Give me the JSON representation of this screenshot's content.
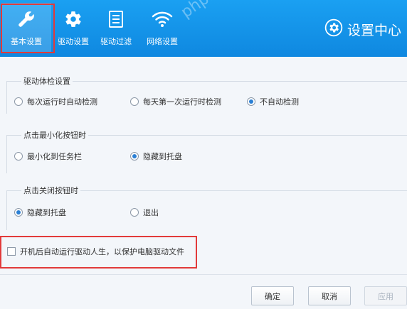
{
  "header": {
    "tabs": [
      {
        "label": "基本设置",
        "icon": "wrench-icon",
        "active": true
      },
      {
        "label": "驱动设置",
        "icon": "gear-icon",
        "active": false
      },
      {
        "label": "驱动过滤",
        "icon": "list-icon",
        "active": false
      },
      {
        "label": "网络设置",
        "icon": "wifi-icon",
        "active": false
      }
    ],
    "title": "设置中心",
    "watermark": "php.cn"
  },
  "groups": {
    "scan": {
      "title": "驱动体检设置",
      "options": [
        {
          "label": "每次运行时自动检测",
          "selected": false
        },
        {
          "label": "每天第一次运行时检测",
          "selected": false
        },
        {
          "label": "不自动检测",
          "selected": true
        }
      ]
    },
    "minimize": {
      "title": "点击最小化按钮时",
      "options": [
        {
          "label": "最小化到任务栏",
          "selected": false
        },
        {
          "label": "隐藏到托盘",
          "selected": true
        }
      ]
    },
    "close": {
      "title": "点击关闭按钮时",
      "options": [
        {
          "label": "隐藏到托盘",
          "selected": true
        },
        {
          "label": "退出",
          "selected": false
        }
      ]
    }
  },
  "autostart": {
    "label": "开机后自动运行驱动人生，以保护电脑驱动文件",
    "checked": false
  },
  "buttons": {
    "ok": "确定",
    "cancel": "取消",
    "apply": "应用"
  },
  "colors": {
    "header": "#1aa0f2",
    "highlight": "#e23a3a",
    "radio_dot": "#2a7fd4"
  }
}
